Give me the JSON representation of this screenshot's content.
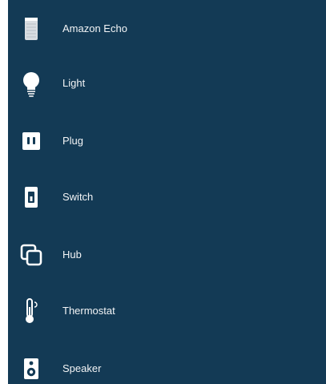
{
  "device_list": {
    "items": [
      {
        "label": "Amazon Echo",
        "icon": "echo-device-icon"
      },
      {
        "label": "Light",
        "icon": "bulb-icon"
      },
      {
        "label": "Plug",
        "icon": "plug-icon"
      },
      {
        "label": "Switch",
        "icon": "switch-icon"
      },
      {
        "label": "Hub",
        "icon": "hub-icon"
      },
      {
        "label": "Thermostat",
        "icon": "thermostat-icon"
      },
      {
        "label": "Speaker",
        "icon": "speaker-icon"
      }
    ]
  },
  "colors": {
    "background": "#133a55",
    "icon": "#ffffff",
    "text": "#ffffff"
  }
}
